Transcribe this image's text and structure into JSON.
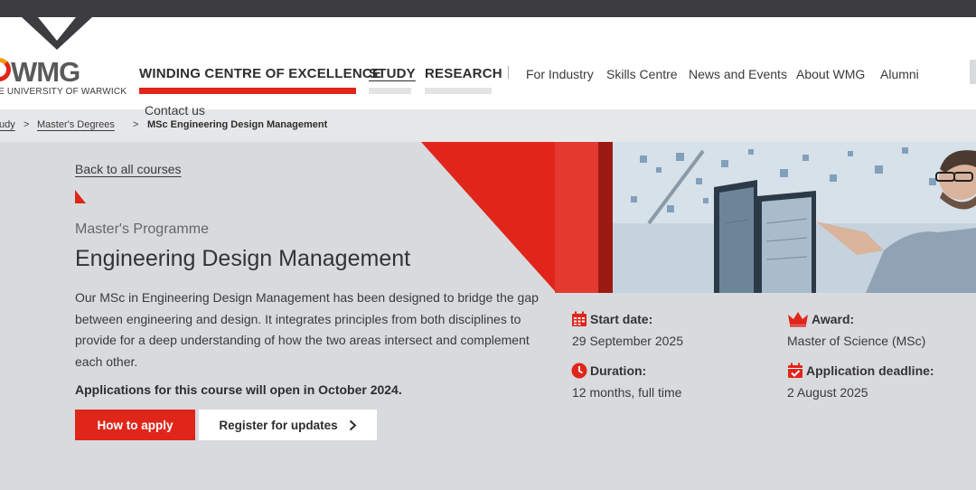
{
  "logo": {
    "text": "WMG",
    "subtitle": "E UNIVERSITY OF WARWICK"
  },
  "nav": {
    "main": [
      {
        "label": "WINDING CENTRE OF EXCELLENCE"
      },
      {
        "label": "STUDY"
      },
      {
        "label": "RESEARCH"
      }
    ],
    "secondary": [
      {
        "label": "For Industry"
      },
      {
        "label": "Skills Centre"
      },
      {
        "label": "News and Events"
      },
      {
        "label": "About WMG"
      },
      {
        "label": "Alumni"
      }
    ],
    "contact": "Contact us"
  },
  "breadcrumb": {
    "items": [
      {
        "label": "udy"
      },
      {
        "label": "Master's Degrees"
      },
      {
        "label": "MSc Engineering Design Management"
      }
    ],
    "separator": ">"
  },
  "course": {
    "back_link": "Back to all courses",
    "eyebrow": "Master's Programme",
    "title": "Engineering Design Management",
    "description": "Our MSc in Engineering Design Management has been designed to bridge the gap between engineering and design. It integrates principles from both disciplines to provide for a deep understanding of how the two areas intersect and complement each other.",
    "notice": "Applications for this course will open in October 2024.",
    "apply_label": "How to apply",
    "register_label": "Register for updates"
  },
  "facts": {
    "start": {
      "label": "Start date:",
      "value": "29 September 2025",
      "icon": "calendar-icon"
    },
    "duration": {
      "label": "Duration:",
      "value": "12 months, full time",
      "icon": "clock-icon"
    },
    "award": {
      "label": "Award:",
      "value": "Master of Science (MSc)",
      "icon": "crown-icon"
    },
    "deadline": {
      "label": "Application deadline:",
      "value": "2 August 2025",
      "icon": "calendar-check-icon"
    }
  },
  "colors": {
    "accent": "#e0261b",
    "dark_bar": "#3d3d3f",
    "panel": "#d8dadd"
  }
}
